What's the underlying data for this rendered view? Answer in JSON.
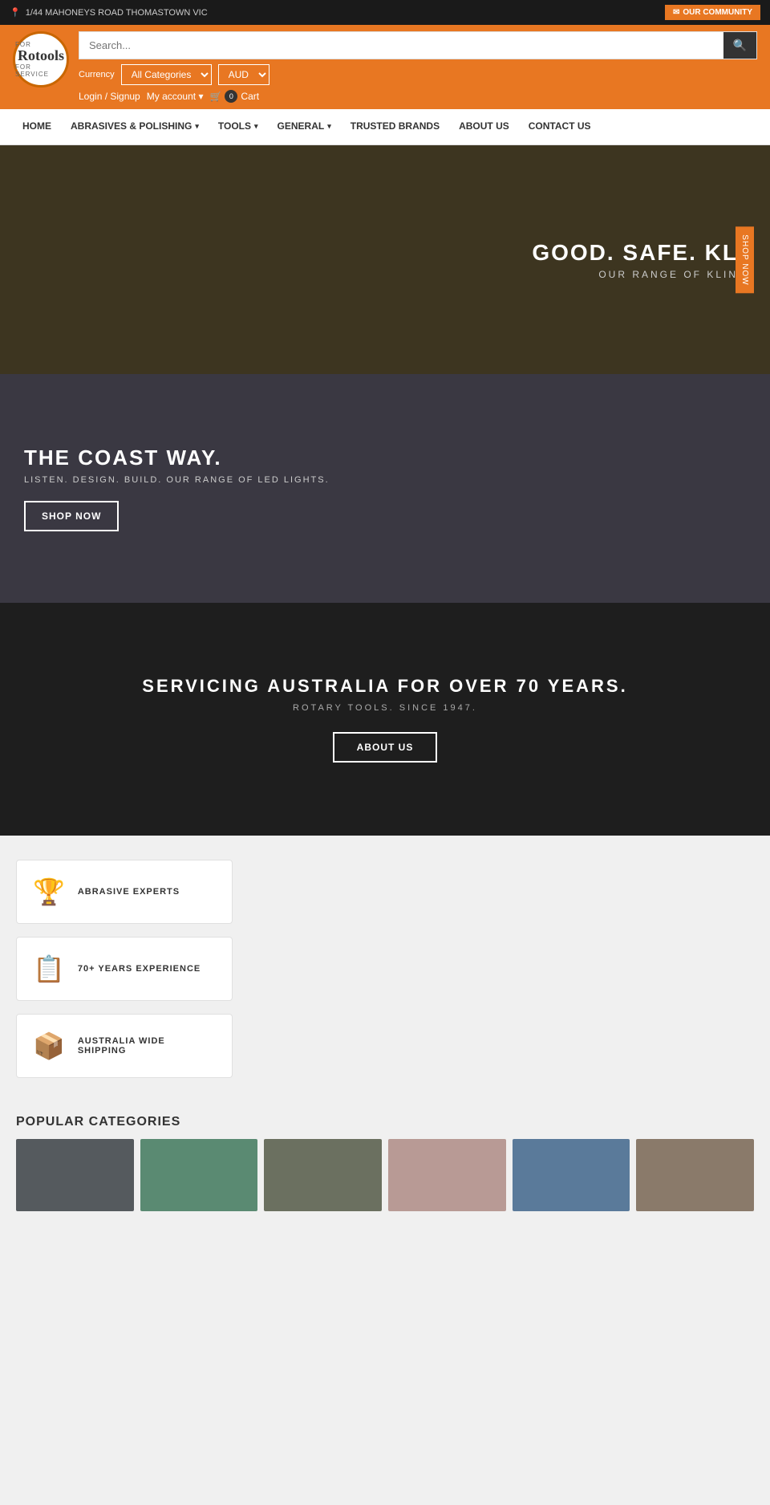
{
  "topbar": {
    "address": "1/44 MAHONEYS ROAD THOMASTOWN VIC",
    "community_button": "OUR COMMUNITY",
    "email_icon": "✉"
  },
  "header": {
    "logo_name": "Rotools",
    "logo_sub": "FOR SERVICE",
    "search_placeholder": "Search...",
    "currency_label": "Currency",
    "currency_value": "AUD",
    "category_label": "All Categories",
    "login_label": "Login / Signup",
    "account_label": "My account",
    "cart_label": "Cart",
    "cart_count": "0"
  },
  "nav": {
    "items": [
      {
        "label": "HOME",
        "has_dropdown": false
      },
      {
        "label": "ABRASIVES & POLISHING",
        "has_dropdown": true
      },
      {
        "label": "TOOLS",
        "has_dropdown": true
      },
      {
        "label": "GENERAL",
        "has_dropdown": true
      },
      {
        "label": "TRUSTED BRANDS",
        "has_dropdown": false
      },
      {
        "label": "ABOUT US",
        "has_dropdown": false
      },
      {
        "label": "CONTACT US",
        "has_dropdown": false
      }
    ]
  },
  "hero1": {
    "title": "GOOD. SAFE. KL",
    "subtitle": "OUR RANGE OF KLIN",
    "button_label": "SHOP NOW"
  },
  "hero2": {
    "title": "THE COAST WAY.",
    "subtitle": "LISTEN. DESIGN. BUILD. OUR RANGE OF LED LIGHTS.",
    "button_label": "SHOP NOW"
  },
  "hero3": {
    "title": "SERVICING AUSTRALIA FOR OVER 70 YEARS.",
    "subtitle": "ROTARY TOOLS. SINCE 1947.",
    "button_label": "ABOUT US"
  },
  "features": [
    {
      "icon": "🏆",
      "label": "ABRASIVE EXPERTS"
    },
    {
      "icon": "📋",
      "label": "70+ YEARS EXPERIENCE"
    },
    {
      "icon": "📦",
      "label": "AUSTRALIA WIDE SHIPPING"
    }
  ],
  "popular": {
    "title": "POPULAR CATEGORIES",
    "categories": [
      {
        "color": "#555a5e"
      },
      {
        "color": "#5a8a72"
      },
      {
        "color": "#6b7060"
      },
      {
        "color": "#b89a95"
      },
      {
        "color": "#5a7a9a"
      },
      {
        "color": "#8a7a6a"
      }
    ]
  }
}
